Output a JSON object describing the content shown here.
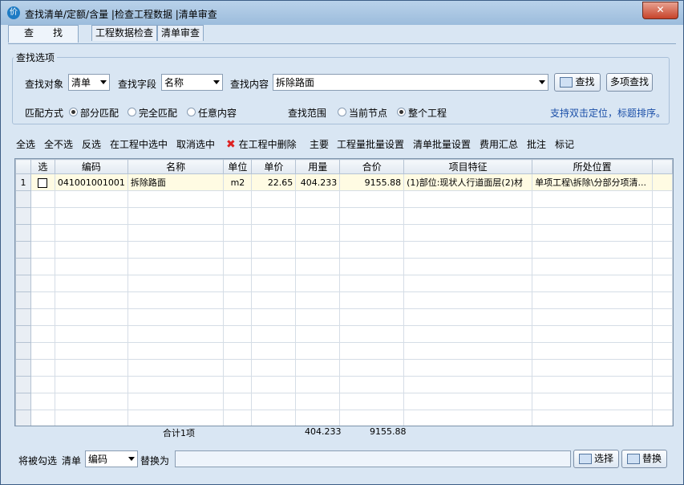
{
  "window": {
    "icon_glyph": "价",
    "title": "查找清单/定额/含量 |检查工程数据 |清单审查",
    "close_glyph": "✕"
  },
  "tabs": [
    {
      "label": "查　　找",
      "active": true
    },
    {
      "label": "工程数据检查",
      "active": false
    },
    {
      "label": "清单审查",
      "active": false
    }
  ],
  "search_options": {
    "group_title": "查找选项",
    "target_label": "查找对象",
    "target_value": "清单",
    "field_label": "查找字段",
    "field_value": "名称",
    "content_label": "查找内容",
    "content_value": "拆除路面",
    "find_button": "查找",
    "multi_find_button": "多项查找",
    "match_label": "匹配方式",
    "match_options": [
      {
        "label": "部分匹配",
        "selected": true
      },
      {
        "label": "完全匹配",
        "selected": false
      },
      {
        "label": "任意内容",
        "selected": false
      }
    ],
    "scope_label": "查找范围",
    "scope_options": [
      {
        "label": "当前节点",
        "selected": false
      },
      {
        "label": "整个工程",
        "selected": true
      }
    ],
    "hint": "支持双击定位，标题排序。"
  },
  "toolbar": {
    "select_all": "全选",
    "select_none": "全不选",
    "invert": "反选",
    "select_in_project": "在工程中选中",
    "unselect": "取消选中",
    "delete_in_project": "在工程中删除",
    "main": "主要",
    "qty_batch": "工程量批量设置",
    "list_batch": "清单批量设置",
    "cost_summary": "费用汇总",
    "annotate": "批注",
    "mark": "标记"
  },
  "table": {
    "columns": [
      "选",
      "编码",
      "名称",
      "单位",
      "单价",
      "用量",
      "合价",
      "项目特征",
      "所处位置"
    ],
    "rows": [
      {
        "index": "1",
        "checked": false,
        "code": "041001001001",
        "name": "拆除路面",
        "unit": "m2",
        "price": "22.65",
        "qty": "404.233",
        "total": "9155.88",
        "feature": "(1)部位:现状人行道面层(2)材",
        "location": "单项工程\\拆除\\分部分项清..."
      }
    ],
    "empty_rows": 15,
    "summary": {
      "label": "合计1项",
      "qty": "404.233",
      "total": "9155.88"
    }
  },
  "bottom": {
    "prefix_label": "将被勾选",
    "type_label": "清单",
    "field_value": "编码",
    "replace_label": "替换为",
    "replace_value": "",
    "select_button": "选择",
    "replace_button": "替换"
  },
  "colors": {
    "accent": "#1b4fa8",
    "selected_row": "#fffbe3",
    "window_bg": "#d9e6f3"
  }
}
